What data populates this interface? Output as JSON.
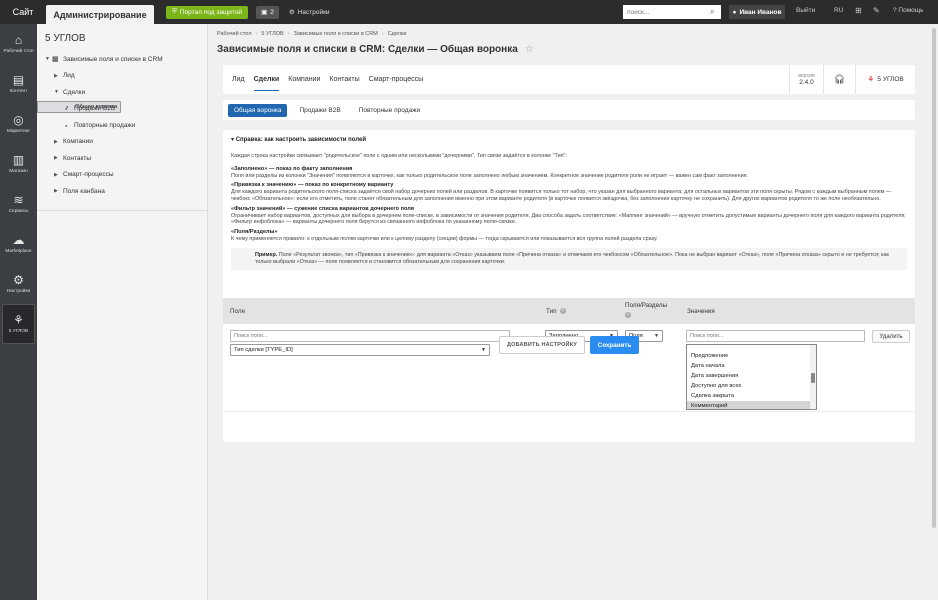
{
  "topbar": {
    "site_label": "Сайт",
    "admin_label": "Администрирование",
    "portal_label": "Портал под защитой",
    "counter_value": "2",
    "settings_label": "Настройки",
    "search_placeholder": "поиск...",
    "user_name": "Иван Иванов",
    "logout_label": "Выйти",
    "lang_label": "RU",
    "help_label": "Помощь"
  },
  "iconbar": [
    {
      "label": "Рабочий стол",
      "icon": "home-icon"
    },
    {
      "label": "Контент",
      "icon": "content-icon"
    },
    {
      "label": "Маркетинг",
      "icon": "target-icon"
    },
    {
      "label": "Магазин",
      "icon": "shop-icon"
    },
    {
      "label": "Сервисы",
      "icon": "layers-icon"
    },
    {
      "label": "Marketplace",
      "icon": "cloud-icon"
    },
    {
      "label": "Настройки",
      "icon": "gear-icon"
    },
    {
      "label": "5 УГЛОВ",
      "icon": "brand-icon"
    }
  ],
  "leftnav": {
    "title": "5 УГЛОВ",
    "items": [
      {
        "label": "Зависимые поля и списки в CRM"
      },
      {
        "label": "Лид"
      },
      {
        "label": "Сделки"
      },
      {
        "label": "Общая воронка"
      },
      {
        "label": "Продажи B2B"
      },
      {
        "label": "Повторные продажи"
      },
      {
        "label": "Компании"
      },
      {
        "label": "Контакты"
      },
      {
        "label": "Смарт-процессы"
      },
      {
        "label": "Поля канбана"
      }
    ]
  },
  "breadcrumbs": [
    "Рабочий стол",
    "5 УГЛОВ",
    "Зависимые поля и списки в CRM",
    "Сделки"
  ],
  "page_title": "Зависимые поля и списки в CRM: Сделки — Общая воронка",
  "tabs": [
    "Лид",
    "Сделки",
    "Компании",
    "Контакты",
    "Смарт-процессы"
  ],
  "version": {
    "label": "версия",
    "value": "2.4.0"
  },
  "brand_label": "5 УГЛОВ",
  "subtabs": [
    "Общая воронка",
    "Продажи B2B",
    "Повторные продажи"
  ],
  "help": {
    "heading": "Справка: как настроить зависимости полей",
    "intro": "Каждая строка настройки связывает \"родительское\" поле с одним или несколькими \"дочерними\". Тип связи задаётся в колонке \"Тип\":",
    "b1_title": "«Заполнено» — показ по факту заполнения",
    "b1_text": "Поля или разделы из колонки \"Значения\" появляются в карточке, как только родительское поле заполнено любым значением. Конкретное значение родителя роли не играет — важен сам факт заполнения.",
    "b2_title": "«Привязка к значению» — показ по конкретному варианту",
    "b2_text": "Для каждого варианта родительского поля-списка задаётся свой набор дочерних полей или разделов. В карточке появится только тот набор, что указан для выбранного варианта; для остальных вариантов эти поля скрыты. Рядом с каждым выбранным полем — чекбокс «Обязательное»: если его отметить, поле станет обязательным для заполнения именно при этом варианте родителя (в карточке появится звёздочка, без заполнения карточку не сохранить). Для других вариантов родителя то же поле необязательно.",
    "b3_title": "«Фильтр значений» — сужение списка вариантов дочернего поля",
    "b3_text": "Ограничивает набор вариантов, доступных для выбора в дочернем поле-списке, в зависимости от значения родителя. Два способа задать соответствие: «Маппинг значений» — вручную отметить допустимые варианты дочернего поля для каждого варианта родителя; «Фильтр инфоблока» — варианты дочернего поля берутся из связанного инфоблока по указанному полю-связке.",
    "b4_title": "«Поля/Разделы»",
    "b4_text": "К чему применяется правило: к отдельным полям карточки или к целому разделу (секции) формы — тогда скрывается или показывается вся группа полей раздела сразу.",
    "example_label": "Пример.",
    "example_text": "Поле «Результат звонка», тип «Привязка к значению»: для варианта «Отказ» указываем поле «Причина отказа» и отмечаем его чекбоксом «Обязательное». Пока не выбран вариант «Отказ», поле «Причина отказа» скрыто и не требуется; как только выбрали «Отказ» — поле появляется и становится обязательным для сохранения карточки."
  },
  "table": {
    "col_field": "Поле",
    "col_type": "Тип",
    "col_fs": "Поля/Разделы",
    "col_values": "Значения",
    "field_search_placeholder": "Поиск поля...",
    "field_value": "Тип сделки [TYPE_ID]",
    "type_value": "Заполнено",
    "fs_value": "Поля",
    "values_search_placeholder": "Поиск поля...",
    "values_list": [
      "Предложение",
      "Дата начала",
      "Дата завершения",
      "Доступно для всех",
      "Сделка закрыта",
      "Комментарий"
    ],
    "delete_label": "Удалить"
  },
  "buttons": {
    "add_label": "ДОБАВИТЬ НАСТРОЙКУ",
    "save_label": "Сохранить"
  },
  "colors": {
    "accent": "#2067b0",
    "save": "#2a8cf0",
    "portal": "#7cb518",
    "topbar": "#2c2c2c"
  }
}
